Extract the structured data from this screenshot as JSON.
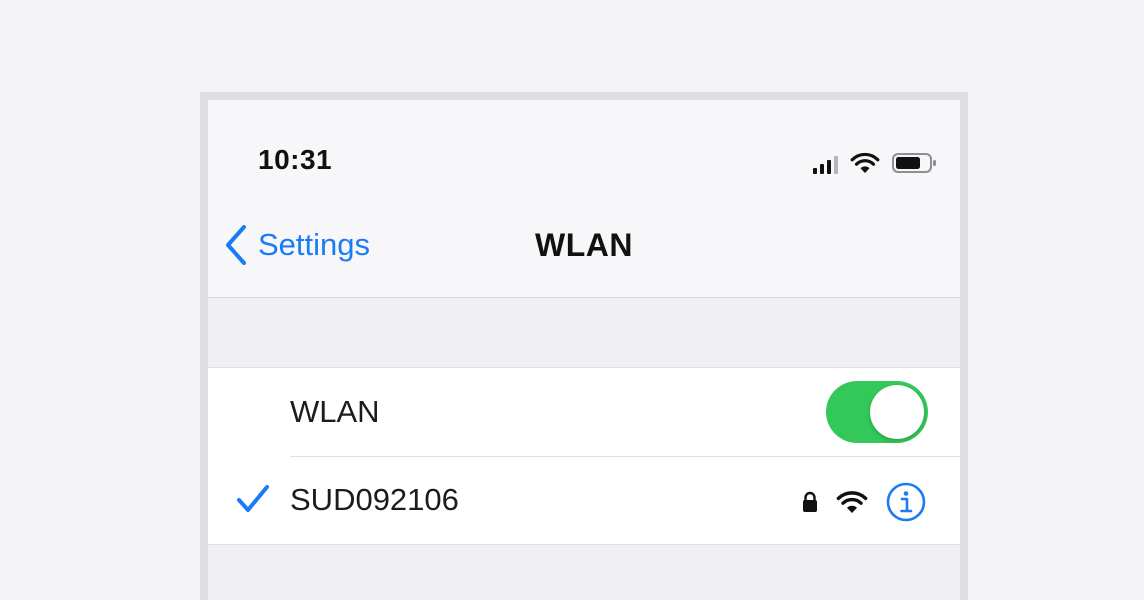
{
  "status_bar": {
    "time": "10:31",
    "icons": [
      "cellular-signal-icon",
      "wifi-icon",
      "battery-icon"
    ]
  },
  "nav": {
    "back_label": "Settings",
    "title": "WLAN"
  },
  "wlan_group": {
    "toggle_label": "WLAN",
    "toggle_on": true,
    "connected_network": "SUD092106",
    "network_icons": [
      "lock-icon",
      "wifi-strength-icon",
      "info-icon"
    ]
  },
  "colors": {
    "accent": "#1a7cf5",
    "toggle_on": "#34c759",
    "background": "#efeff4"
  }
}
